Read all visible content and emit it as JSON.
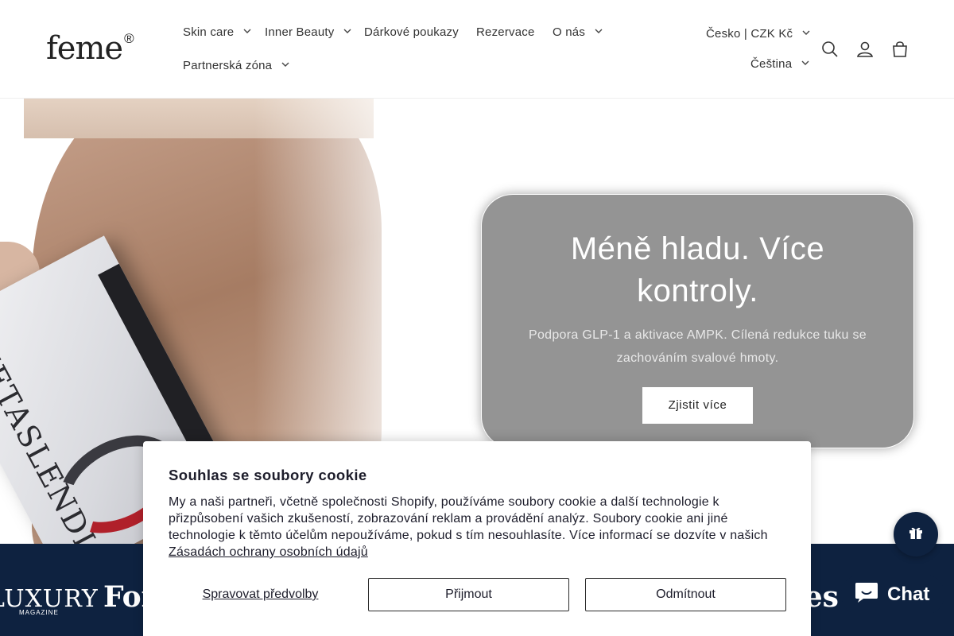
{
  "header": {
    "logo_text": "feme",
    "logo_mark": "®",
    "nav": [
      {
        "label": "Skin care",
        "has_dropdown": true
      },
      {
        "label": "Inner Beauty",
        "has_dropdown": true
      },
      {
        "label": "Dárkové poukazy",
        "has_dropdown": false
      },
      {
        "label": "Rezervace",
        "has_dropdown": false
      },
      {
        "label": "O nás",
        "has_dropdown": true
      },
      {
        "label": "Partnerská zóna",
        "has_dropdown": true
      }
    ],
    "country_currency": "Česko | CZK Kč",
    "language": "Čeština",
    "icons": [
      "search-icon",
      "account-icon",
      "cart-icon"
    ]
  },
  "hero": {
    "product_text": "METASLENDIA",
    "title": "Méně hladu. Více kontroly.",
    "subtitle": "Podpora GLP-1 a aktivace AMPK. Cílená redukce tuku se zachováním svalové hmoty.",
    "cta": "Zjistit více"
  },
  "press": {
    "logos": [
      "LUXURY",
      "MAGAZINE",
      "Forbes",
      "Forbes"
    ]
  },
  "cookie": {
    "title": "Souhlas se soubory cookie",
    "text": "My a naši partneři, včetně společnosti Shopify, používáme soubory cookie a další technologie k přizpůsobení vašich zkušeností, zobrazování reklam a provádění analýz. Soubory cookie ani jiné technologie k těmto účelům nepoužíváme, pokud s tím nesouhlasíte. Více informací se dozvíte v našich",
    "link": "Zásadách ochrany osobních údajů",
    "manage": "Spravovat předvolby",
    "accept": "Přijmout",
    "decline": "Odmítnout"
  },
  "widgets": {
    "chat_label": "Chat"
  },
  "colors": {
    "navy": "#0e2240",
    "hero_card": "#949494"
  }
}
